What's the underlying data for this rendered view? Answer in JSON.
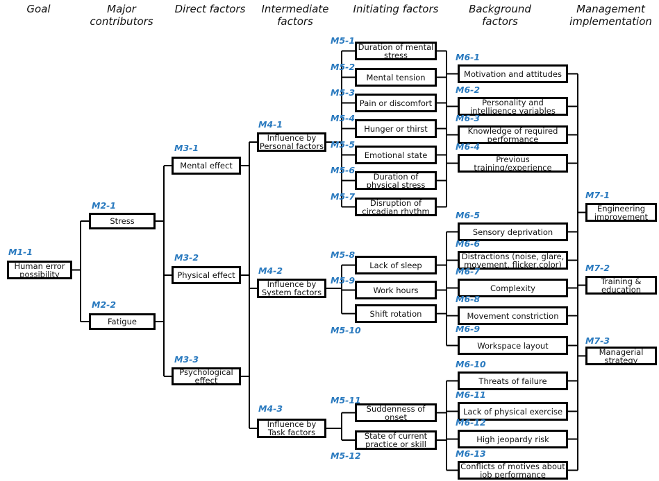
{
  "headers": [
    "Goal",
    "Major\ncontributors",
    "Direct factors",
    "Intermediate\nfactors",
    "Initiating factors",
    "Background\nfactors",
    "Management\nimplementation"
  ],
  "nodes": {
    "M1-1": "Human error possibility",
    "M2-1": "Stress",
    "M2-2": "Fatigue",
    "M3-1": "Mental effect",
    "M3-2": "Physical effect",
    "M3-3": "Psychological effect",
    "M4-1": "Influence by Personal factors",
    "M4-2": "Influence by System factors",
    "M4-3": "Influence by Task factors",
    "M5-1": "Duration of mental stress",
    "M5-2": "Mental tension",
    "M5-3": "Pain or discomfort",
    "M5-4": "Hunger or thirst",
    "M5-5": "Emotional state",
    "M5-6": "Duration of physical stress",
    "M5-7": "Disruption of circadian rhythm",
    "M5-8": "Lack of sleep",
    "M5-9": "Work hours",
    "M5-10": "Shift rotation",
    "M5-11": "Suddenness of onset",
    "M5-12": "State of current practice or skill",
    "M6-1": "Motivation and attitudes",
    "M6-2": "Personality and intelligence variables",
    "M6-3": "Knowledge of required performance",
    "M6-4": "Previous training/experience",
    "M6-5": "Sensory deprivation",
    "M6-6": "Distractions (noise, glare, movement, flicker,color)",
    "M6-7": "Complexity",
    "M6-8": "Movement constriction",
    "M6-9": "Workspace layout",
    "M6-10": "Threats of failure",
    "M6-11": "Lack of physical exercise",
    "M6-12": "High jeopardy risk",
    "M6-13": "Conflicts of motives about job performance",
    "M7-1": "Engineering improvement",
    "M7-2": "Training & education",
    "M7-3": "Managerial strategy"
  },
  "colors": {
    "code": "#2a7abf",
    "line": "#000000"
  }
}
